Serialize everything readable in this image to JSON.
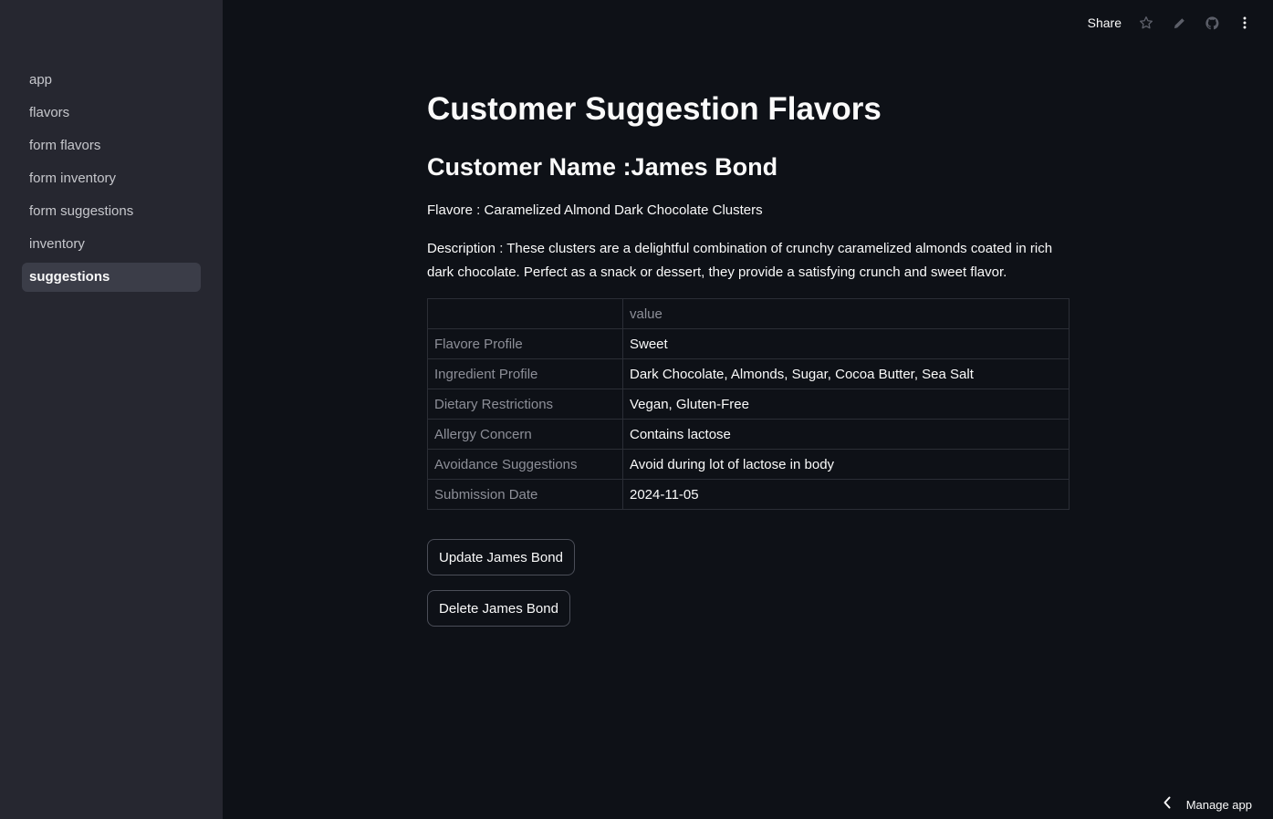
{
  "sidebar": {
    "items": [
      {
        "label": "app"
      },
      {
        "label": "flavors"
      },
      {
        "label": "form flavors"
      },
      {
        "label": "form inventory"
      },
      {
        "label": "form suggestions"
      },
      {
        "label": "inventory"
      },
      {
        "label": "suggestions",
        "active": true
      }
    ]
  },
  "toolbar": {
    "share_label": "Share",
    "icons": [
      "star-icon",
      "edit-icon",
      "github-icon",
      "more-menu-icon"
    ]
  },
  "main": {
    "title": "Customer Suggestion Flavors",
    "customer_heading": "Customer Name :James Bond",
    "flavor_line": "Flavore : Caramelized Almond Dark Chocolate Clusters",
    "description_line": "Description : These clusters are a delightful combination of crunchy caramelized almonds coated in rich dark chocolate. Perfect as a snack or dessert, they provide a satisfying crunch and sweet flavor.",
    "table": {
      "columns": [
        "",
        "value"
      ],
      "rows": [
        {
          "label": "Flavore Profile",
          "value": "Sweet"
        },
        {
          "label": "Ingredient Profile",
          "value": "Dark Chocolate, Almonds, Sugar, Cocoa Butter, Sea Salt"
        },
        {
          "label": "Dietary Restrictions",
          "value": "Vegan, Gluten-Free"
        },
        {
          "label": "Allergy Concern",
          "value": "Contains lactose"
        },
        {
          "label": "Avoidance Suggestions",
          "value": "Avoid during lot of lactose in body"
        },
        {
          "label": "Submission Date",
          "value": "2024-11-05"
        }
      ]
    },
    "update_button": "Update James Bond",
    "delete_button": "Delete James Bond"
  },
  "footer": {
    "manage_label": "Manage app"
  },
  "colors": {
    "background": "#0e1117",
    "sidebar": "#262730",
    "active_item": "#3b3d48",
    "text": "#fafafa",
    "muted_text": "#8d8f98"
  }
}
